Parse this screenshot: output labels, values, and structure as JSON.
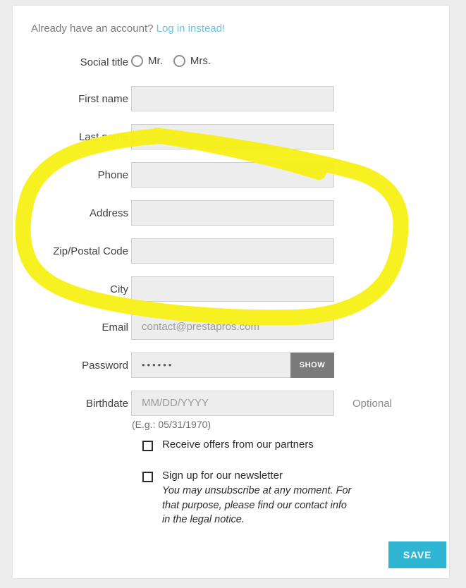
{
  "header": {
    "account_prompt": "Already have an account?",
    "login_link": "Log in instead!"
  },
  "form": {
    "social_title": {
      "label": "Social title",
      "options": [
        {
          "label": "Mr.",
          "selected": false
        },
        {
          "label": "Mrs.",
          "selected": false
        }
      ]
    },
    "fields": [
      {
        "label": "First name",
        "value": "",
        "placeholder": ""
      },
      {
        "label": "Last name",
        "value": "",
        "placeholder": ""
      },
      {
        "label": "Phone",
        "value": "",
        "placeholder": ""
      },
      {
        "label": "Address",
        "value": "",
        "placeholder": ""
      },
      {
        "label": "Zip/Postal Code",
        "value": "",
        "placeholder": ""
      },
      {
        "label": "City",
        "value": "",
        "placeholder": ""
      }
    ],
    "email": {
      "label": "Email",
      "value": "contact@prestapros.com"
    },
    "password": {
      "label": "Password",
      "masked_value": "••••••",
      "show_button": "SHOW"
    },
    "birthdate": {
      "label": "Birthdate",
      "placeholder": "MM/DD/YYYY",
      "optional_tag": "Optional",
      "hint": "(E.g.: 05/31/1970)"
    },
    "checkboxes": [
      {
        "label": "Receive offers from our partners",
        "checked": false,
        "sub": ""
      },
      {
        "label": "Sign up for our newsletter",
        "checked": false,
        "sub": "You may unsubscribe at any moment. For that purpose, please find our contact info in the legal notice."
      }
    ],
    "save_button": "SAVE"
  },
  "annotation": {
    "type": "highlighter-circle",
    "color": "#f7f11a",
    "encircles": [
      "Phone",
      "Address",
      "Zip/Postal Code",
      "City"
    ]
  },
  "colors": {
    "page_background": "#ededed",
    "card_background": "#ffffff",
    "link": "#6bc4dc",
    "accent_button": "#2fb5d2",
    "show_button": "#7a7a7a",
    "input_background": "#ededed",
    "label_text": "#414141",
    "highlighter": "#f7f11a"
  }
}
